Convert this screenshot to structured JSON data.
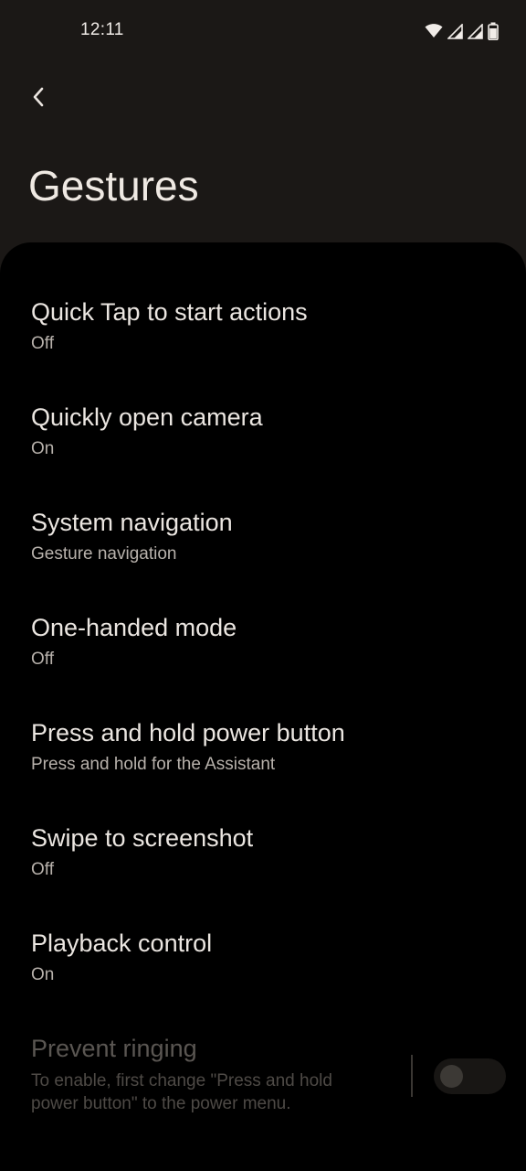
{
  "status_bar": {
    "time": "12:11",
    "icons": [
      "wifi-icon",
      "signal-icon",
      "signal-icon",
      "battery-icon"
    ]
  },
  "header": {
    "back_icon": "chevron-left-icon",
    "title": "Gestures"
  },
  "settings": [
    {
      "title": "Quick Tap to start actions",
      "summary": "Off",
      "enabled": true
    },
    {
      "title": "Quickly open camera",
      "summary": "On",
      "enabled": true
    },
    {
      "title": "System navigation",
      "summary": "Gesture navigation",
      "enabled": true
    },
    {
      "title": "One-handed mode",
      "summary": "Off",
      "enabled": true
    },
    {
      "title": "Press and hold power button",
      "summary": "Press and hold for the Assistant",
      "enabled": true
    },
    {
      "title": "Swipe to screenshot",
      "summary": "Off",
      "enabled": true
    },
    {
      "title": "Playback control",
      "summary": "On",
      "enabled": true
    },
    {
      "title": "Prevent ringing",
      "summary": "To enable, first change \"Press and hold power button\" to the power menu.",
      "enabled": false,
      "toggle_on": false
    }
  ]
}
